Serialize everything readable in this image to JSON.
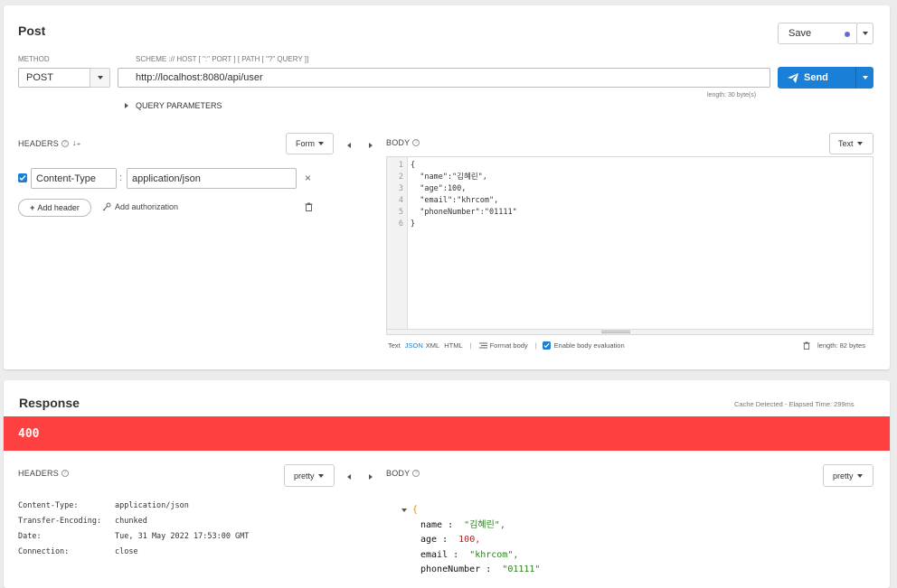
{
  "request": {
    "title": "Post",
    "save_label": "Save",
    "method_label": "METHOD",
    "method_value": "POST",
    "url_hint": "SCHEME :// HOST [ \":\" PORT ] [ PATH [ \"?\" QUERY ]]",
    "url_value": "http://localhost:8080/api/user",
    "url_length": "length: 30 byte(s)",
    "send_label": "Send",
    "query_params_label": "QUERY PARAMETERS",
    "headers_label": "HEADERS",
    "form_label": "Form",
    "header_name": "Content-Type",
    "header_sep": ":",
    "header_value": "application/json",
    "add_header_label": "Add header",
    "add_auth_label": "Add authorization",
    "body_label": "BODY",
    "body_mode": "Text",
    "code_lines": [
      {
        "num": "1",
        "text": "{"
      },
      {
        "num": "2",
        "text": "  \"name\":\"김혜린\","
      },
      {
        "num": "3",
        "text": "  \"age\":100,"
      },
      {
        "num": "4",
        "text": "  \"email\":\"khrcom\","
      },
      {
        "num": "5",
        "text": "  \"phoneNumber\":\"01111\""
      },
      {
        "num": "6",
        "text": "}"
      }
    ],
    "body_formats": [
      "Text",
      "JSON",
      "XML",
      "HTML"
    ],
    "format_body_label": "Format body",
    "enable_eval_label": "Enable body evaluation",
    "body_length": "length: 82 bytes"
  },
  "response": {
    "title": "Response",
    "meta": "Cache Detected - Elapsed Time: 299ms",
    "status_code": "400",
    "status_color": "#ff4040",
    "headers_label": "HEADERS",
    "headers_mode": "pretty",
    "body_label": "BODY",
    "body_mode": "pretty",
    "headers": [
      {
        "key": "Content-Type:",
        "value": "application/json"
      },
      {
        "key": "Transfer-Encoding:",
        "value": "chunked"
      },
      {
        "key": "Date:",
        "value": "Tue, 31 May 2022 17:53:00 GMT"
      },
      {
        "key": "Connection:",
        "value": "close"
      }
    ],
    "json_open": "{",
    "json_fields": [
      {
        "key": "name",
        "value": "\"김혜린\","
      },
      {
        "key": "age",
        "value": "100,"
      },
      {
        "key": "email",
        "value": "\"khrcom\","
      },
      {
        "key": "phoneNumber",
        "value": "\"01111\""
      }
    ]
  },
  "colors": {
    "accent": "#1a7fd6",
    "status_error": "#ff4040",
    "json_string": "#2e7d1f",
    "json_number": "#b02323",
    "save_dot": "#6a6ad6"
  }
}
